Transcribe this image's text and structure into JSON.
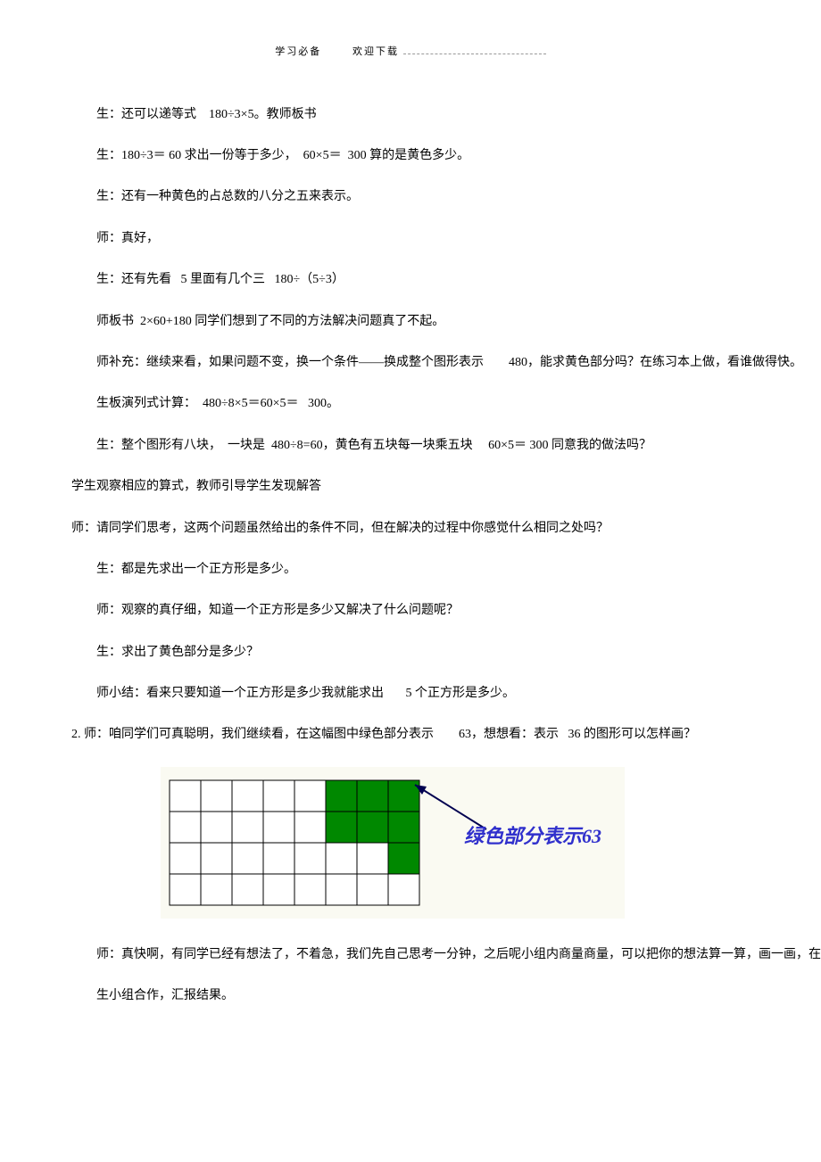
{
  "header": {
    "left": "学习必备",
    "right": "欢迎下载"
  },
  "paragraphs": {
    "p1": "生：还可以递等式    180÷3×5。教师板书",
    "p2": "生：180÷3＝ 60 求出一份等于多少，  60×5＝  300 算的是黄色多少。",
    "p3": "生：还有一种黄色的占总数的八分之五来表示。",
    "p4": "师：真好，",
    "p5": "生：还有先看   5 里面有几个三   180÷（5÷3）",
    "p6": "师板书  2×60+180 同学们想到了不同的方法解决问题真了不起。",
    "p7": "师补充：继续来看，如果问题不变，换一个条件——换成整个图形表示        480，能求黄色部分吗？在练习本上做，看谁做得快。",
    "p8": "生板演列式计算：  480÷8×5＝60×5＝   300。",
    "p9": "生：整个图形有八块，  一块是  480÷8=60，黄色有五块每一块乘五块     60×5＝ 300 同意我的做法吗？",
    "p10": "学生观察相应的算式，教师引导学生发现解答",
    "p11": "师：请同学们思考，这两个问题虽然给出的条件不同，但在解决的过程中你感觉什么相同之处吗？",
    "p12": "生：都是先求出一个正方形是多少。",
    "p13": "师：观察的真仔细，知道一个正方形是多少又解决了什么问题呢？",
    "p14": "生：求出了黄色部分是多少？",
    "p15": "师小结：看来只要知道一个正方形是多少我就能求出       5 个正方形是多少。",
    "p16": "2. 师：咱同学们可真聪明，我们继续看，在这幅图中绿色部分表示        63，想想看：表示   36 的图形可以怎样画？",
    "p17": "师：真快啊，有同学已经有想法了，不着急，我们先自己思考一分钟，之后呢小组内商量商量，可以把你的想法算一算，画一画，在练习纸上写一些，开始吧。",
    "p18": "生小组合作，汇报结果。"
  },
  "chart_data": {
    "type": "grid-diagram",
    "rows": 4,
    "cols": 8,
    "green_cells": [
      {
        "row": 0,
        "col": 5
      },
      {
        "row": 0,
        "col": 6
      },
      {
        "row": 0,
        "col": 7
      },
      {
        "row": 1,
        "col": 5
      },
      {
        "row": 1,
        "col": 6
      },
      {
        "row": 1,
        "col": 7
      },
      {
        "row": 2,
        "col": 7
      }
    ],
    "label": "绿色部分表示63",
    "label_value": 63
  }
}
